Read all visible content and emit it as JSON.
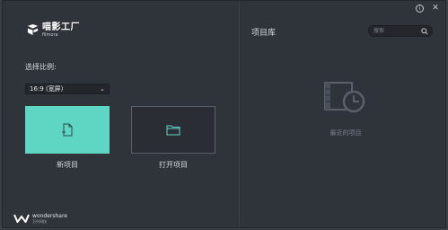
{
  "window": {
    "controls": {
      "info": "i",
      "close": "✕"
    }
  },
  "logo": {
    "name_cn": "喵影工厂",
    "name_en": "filmora",
    "icon": "filmora-logo-icon"
  },
  "left_panel": {
    "ratio_label": "选择比例:",
    "ratio_value": "16:9 (宽屏)",
    "new_project": {
      "label": "新项目",
      "icon": "new-file-icon"
    },
    "open_project": {
      "label": "打开项目",
      "icon": "folder-icon"
    }
  },
  "brand": {
    "name_en": "wondershare",
    "name_cn": "万兴科技",
    "icon": "wondershare-logo-icon"
  },
  "library": {
    "title": "项目库",
    "search_placeholder": "搜索",
    "empty_text": "最近的项目",
    "empty_icon": "film-clock-icon"
  },
  "colors": {
    "background": "#2f343b",
    "accent": "#5fd6c4",
    "panel_dark": "#23272c"
  }
}
